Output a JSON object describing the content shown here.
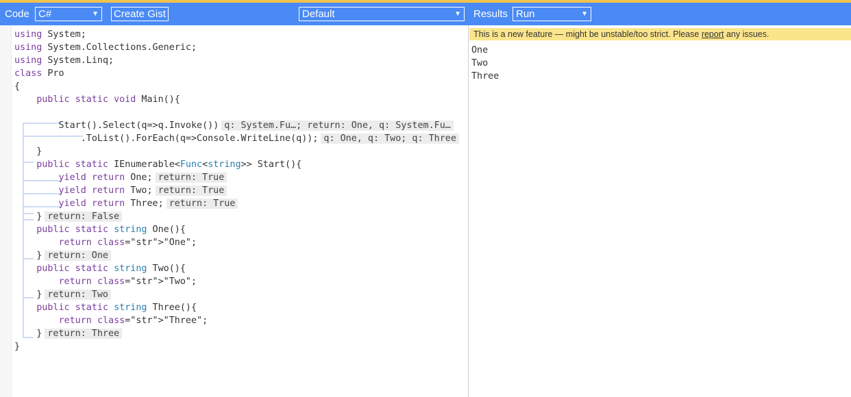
{
  "toolbar": {
    "code_label": "Code",
    "language": "C#",
    "create_gist": "Create Gist",
    "mode": "Default",
    "results_label": "Results",
    "run_mode": "Run"
  },
  "code_lines": [
    {
      "text": "using System;"
    },
    {
      "text": "using System.Collections.Generic;"
    },
    {
      "text": "using System.Linq;"
    },
    {
      "text": "class Pro"
    },
    {
      "text": "{"
    },
    {
      "text": "    public static void Main(){"
    },
    {
      "text": ""
    },
    {
      "text": "        Start().Select(q=>q.Invoke())",
      "note": "q: System.Fu…; return: One, q: System.Fu…"
    },
    {
      "text": "            .ToList().ForEach(q=>Console.WriteLine(q));",
      "note": "q: One, q: Two; q: Three"
    },
    {
      "text": "    }"
    },
    {
      "text": "    public static IEnumerable<Func<string>> Start(){"
    },
    {
      "text": "        yield return One;",
      "note": "return: True"
    },
    {
      "text": "        yield return Two;",
      "note": "return: True"
    },
    {
      "text": "        yield return Three;",
      "note": "return: True"
    },
    {
      "text": "    }",
      "note": "return: False"
    },
    {
      "text": "    public static string One(){"
    },
    {
      "text": "        return \"One\";"
    },
    {
      "text": "    }",
      "note": "return: One"
    },
    {
      "text": "    public static string Two(){"
    },
    {
      "text": "        return \"Two\";"
    },
    {
      "text": "    }",
      "note": "return: Two"
    },
    {
      "text": "    public static string Three(){"
    },
    {
      "text": "        return \"Three\";"
    },
    {
      "text": "    }",
      "note": "return: Three"
    },
    {
      "text": "}"
    }
  ],
  "banner": {
    "before": "This is a new feature — might be unstable/too strict. Please ",
    "link": "report",
    "after": " any issues."
  },
  "results": [
    "One",
    "Two",
    "Three"
  ],
  "colors": {
    "toolbar": "#4a8af4",
    "top_stripe": "#f4c24d",
    "banner": "#fbe58b",
    "keyword": "#7a3e9d",
    "type": "#2a7fb0",
    "string": "#a33a2c",
    "flow_arrow": "#9cb8e8"
  },
  "icons": [
    "dropdown-arrow-icon",
    "flow-arrow-icon"
  ]
}
